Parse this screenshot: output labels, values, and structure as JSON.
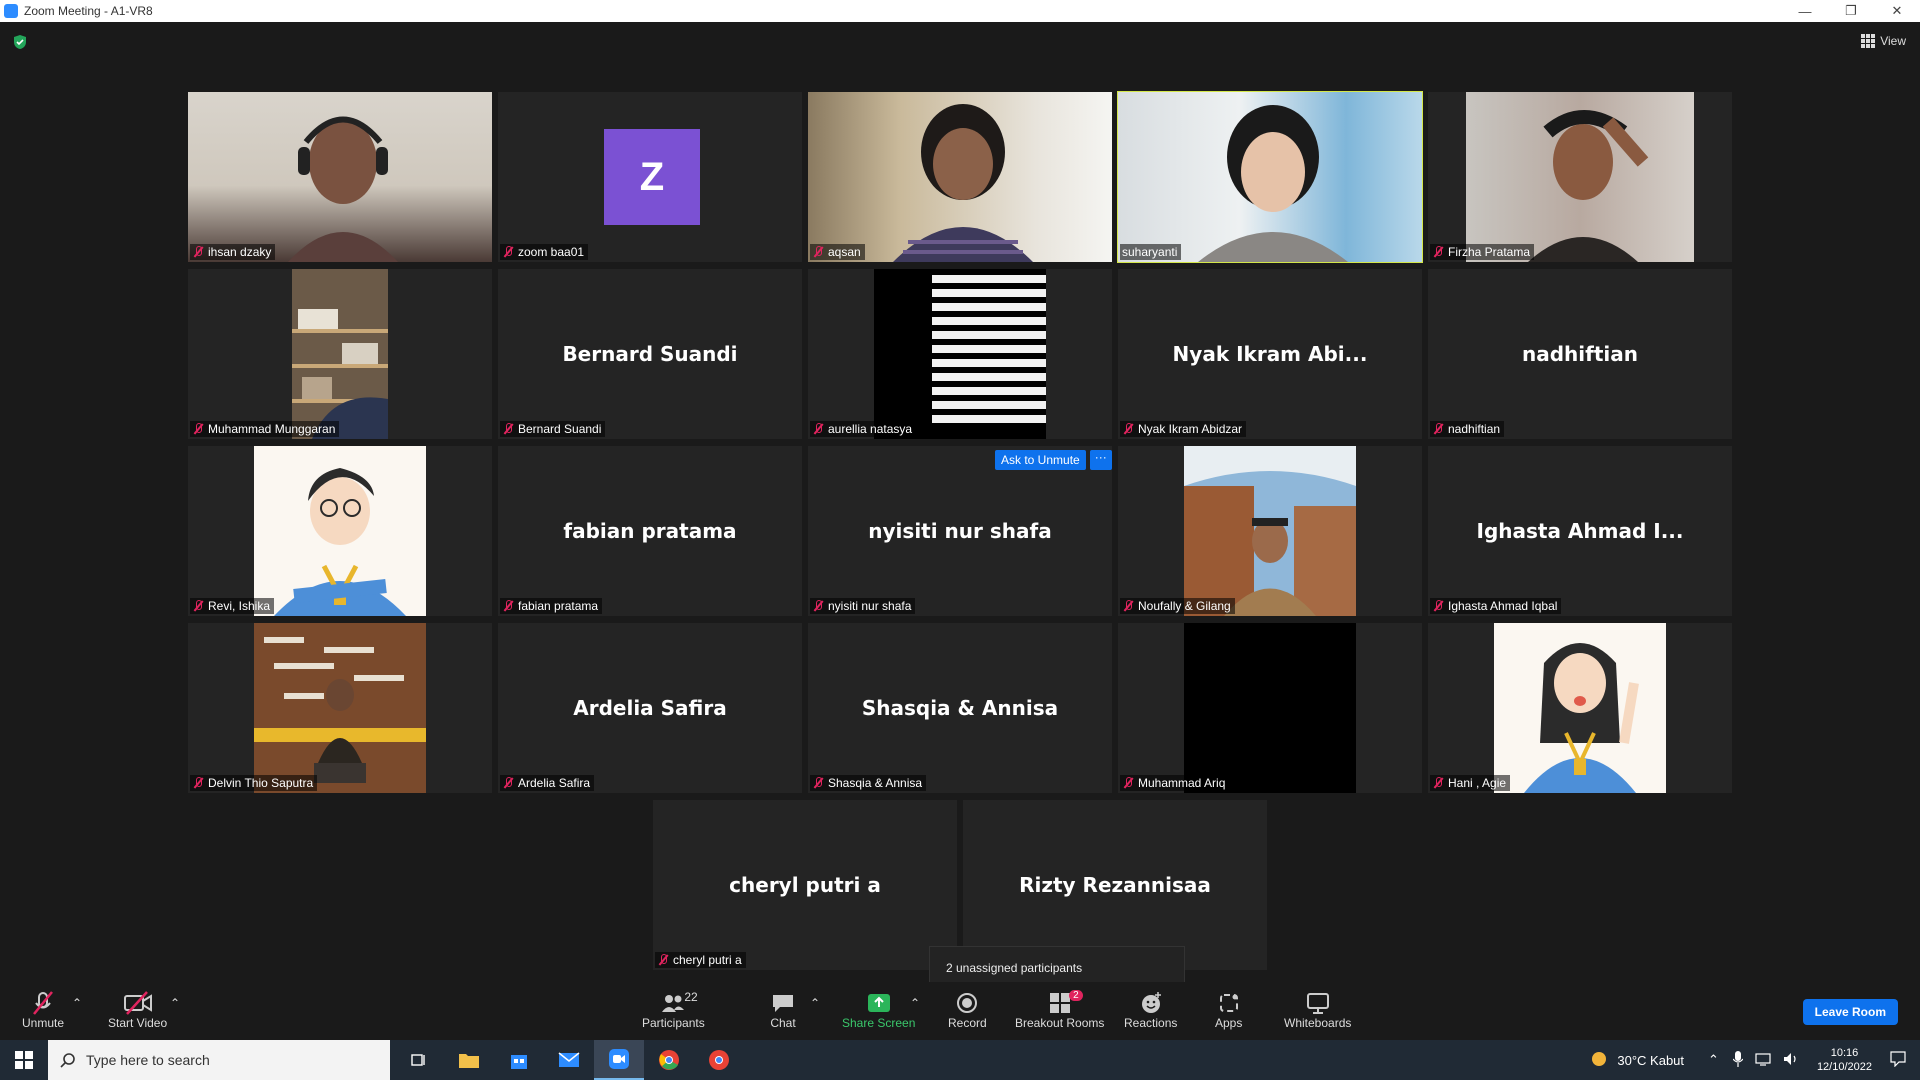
{
  "window": {
    "title": "Zoom Meeting - A1-VR8"
  },
  "header": {
    "view_label": "View"
  },
  "tiles": [
    {
      "name": "ihsan dzaky",
      "big": ""
    },
    {
      "name": "zoom baa01",
      "big": "",
      "avatar": "Z"
    },
    {
      "name": "aqsan",
      "big": ""
    },
    {
      "name": "suharyanti",
      "big": "",
      "active": true
    },
    {
      "name": "Firzha Pratama",
      "big": ""
    },
    {
      "name": "Muhammad Munggaran",
      "big": ""
    },
    {
      "name": "Bernard Suandi",
      "big": "Bernard Suandi"
    },
    {
      "name": "aurellia natasya",
      "big": ""
    },
    {
      "name": "Nyak Ikram Abidzar",
      "big": "Nyak Ikram Abi..."
    },
    {
      "name": "nadhiftian",
      "big": "nadhiftian"
    },
    {
      "name": "Revi, Ishika",
      "big": ""
    },
    {
      "name": "fabian pratama",
      "big": "fabian pratama"
    },
    {
      "name": "nyisiti nur shafa",
      "big": "nyisiti nur shafa"
    },
    {
      "name": "Noufally & Gilang",
      "big": ""
    },
    {
      "name": "Ighasta Ahmad Iqbal",
      "big": "Ighasta Ahmad I..."
    },
    {
      "name": "Delvin Thio Saputra",
      "big": ""
    },
    {
      "name": "Ardelia Safira",
      "big": "Ardelia Safira"
    },
    {
      "name": "Shasqia & Annisa",
      "big": "Shasqia & Annisa"
    },
    {
      "name": "Muhammad Ariq",
      "big": ""
    },
    {
      "name": "Hani , Agie",
      "big": ""
    },
    {
      "name": "cheryl putri a",
      "big": "cheryl putri a"
    },
    {
      "name": "",
      "big": "Rizty Rezannisaa"
    }
  ],
  "ask_to_unmute": {
    "label": "Ask to Unmute",
    "more": "···"
  },
  "tooltip": "2 unassigned participants",
  "toolbar": {
    "unmute": "Unmute",
    "start_video": "Start Video",
    "participants": "Participants",
    "participants_count": "22",
    "chat": "Chat",
    "share_screen": "Share Screen",
    "record": "Record",
    "breakout_rooms": "Breakout Rooms",
    "breakout_badge": "2",
    "reactions": "Reactions",
    "apps": "Apps",
    "whiteboards": "Whiteboards",
    "leave": "Leave Room"
  },
  "taskbar": {
    "search_placeholder": "Type here to search",
    "weather": "30°C  Kabut",
    "time": "10:16",
    "date": "12/10/2022"
  },
  "colors": {
    "accent": "#0e72ed",
    "active_border": "#d4e74a",
    "mute": "#e0245e"
  }
}
